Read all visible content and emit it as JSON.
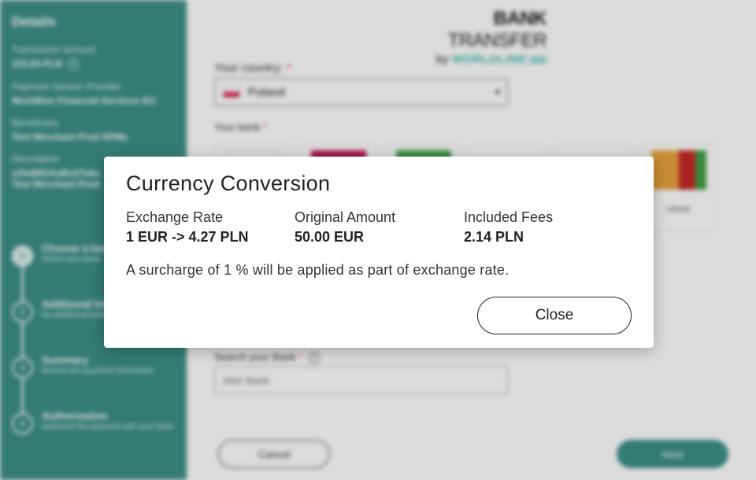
{
  "sidebar": {
    "title": "Details",
    "transaction_amount_label": "Transaction amount",
    "transaction_amount_value": "215.84 PLN",
    "psp_label": "Payment Service Provider",
    "psp_value": "Worldline Financial Services EU",
    "beneficiary_label": "Beneficiary",
    "beneficiary_value": "Test Merchant Prod APMs",
    "description_label": "Description",
    "description_value_1": "x2hdMGAxBx27nbx",
    "description_value_2": "Test Merchant Prod",
    "steps": [
      {
        "number": "1",
        "title": "Choose a bank",
        "desc": "Select your bank"
      },
      {
        "number": "2",
        "title": "Additional Information",
        "desc": "No additional information required"
      },
      {
        "number": "3",
        "title": "Summary",
        "desc": "Review the payment information"
      },
      {
        "number": "4",
        "title": "Authorization",
        "desc": "Authorize the payment with your bank"
      }
    ]
  },
  "brand": {
    "title_bold": "BANK",
    "title_rest": " TRANSFER",
    "by": "by",
    "worldline": "WORLDLINE"
  },
  "form": {
    "country_label": "Your country:",
    "required_mark": "*",
    "country_value": "Poland",
    "bank_label": "Your bank",
    "banks": [
      {
        "name": "",
        "color": "#ffffff"
      },
      {
        "name": "",
        "color": "#c2185b"
      },
      {
        "name": "",
        "color": "#43a047"
      },
      {
        "name": "",
        "color": "#ffffff"
      },
      {
        "name": "",
        "color": "#ffffff"
      },
      {
        "name": "mBank",
        "color": "#e8a33d"
      }
    ],
    "search_label": "Search your Bank",
    "search_placeholder": "Alior Bank",
    "cancel_label": "Cancel",
    "next_label": "Next"
  },
  "modal": {
    "title": "Currency Conversion",
    "exchange_rate_label": "Exchange Rate",
    "exchange_rate_value": "1 EUR -> 4.27 PLN",
    "original_amount_label": "Original Amount",
    "original_amount_value": "50.00 EUR",
    "included_fees_label": "Included Fees",
    "included_fees_value": "2.14 PLN",
    "surcharge_text": "A surcharge of 1 % will be applied as part of exchange rate.",
    "close_label": "Close"
  },
  "colors": {
    "sidebar_teal": "#3d9088",
    "worldline_green": "#46beaa",
    "required_red": "#e53935"
  }
}
